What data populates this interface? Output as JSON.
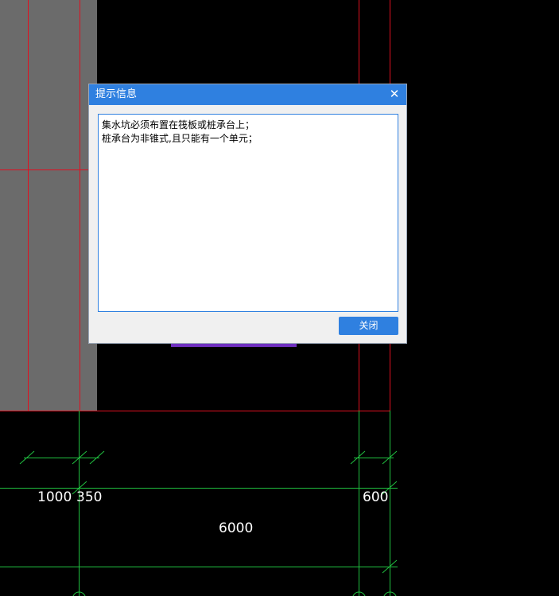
{
  "dialog": {
    "title": "提示信息",
    "close_icon": "close-icon",
    "message_lines": [
      "集水坑必须布置在筏板或桩承台上；",
      "桩承台为非锥式,且只能有一个单元；"
    ],
    "close_button_label": "关闭"
  },
  "drawing": {
    "dimensions": [
      "1000",
      "350",
      "600",
      "6000"
    ],
    "colors": {
      "background": "#000000",
      "boundary_lines": "#e01020",
      "dimension_lines": "#20c040",
      "slab_fill": "#6b6b6b",
      "hidden_element": "#7030c0"
    }
  }
}
